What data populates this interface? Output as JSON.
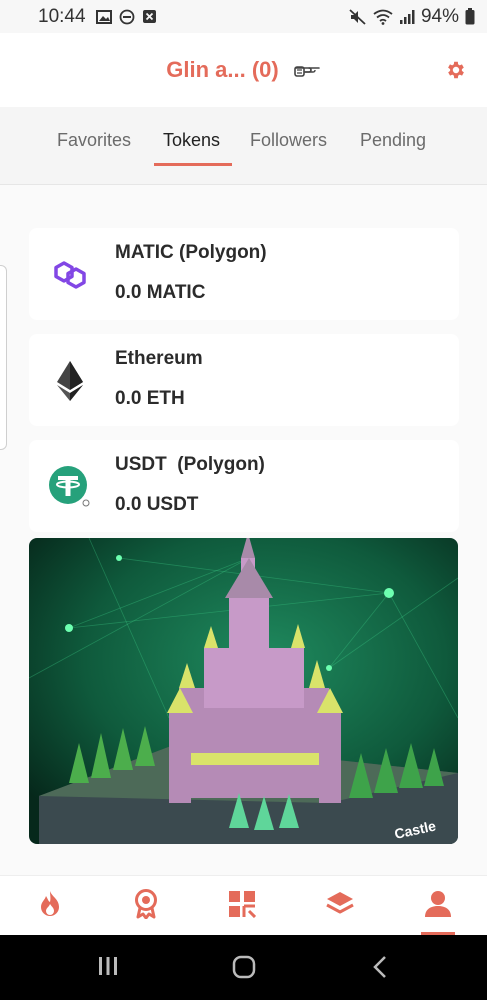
{
  "status_bar": {
    "time": "10:44",
    "battery": "94%",
    "icons_left": [
      "image-icon",
      "dnd-icon",
      "close-box-icon"
    ],
    "icons_right": [
      "mute-icon",
      "wifi-icon",
      "signal-icon",
      "battery-icon"
    ]
  },
  "header": {
    "title": "Glin a... (0)",
    "pointer_icon": "pointing-hand-icon",
    "settings_icon": "gear-icon",
    "accent_color": "#e46b5a"
  },
  "tabs": [
    {
      "label": "Favorites",
      "active": false
    },
    {
      "label": "Tokens",
      "active": true
    },
    {
      "label": "Followers",
      "active": false
    },
    {
      "label": "Pending",
      "active": false
    }
  ],
  "tokens": [
    {
      "name": "MATIC (Polygon)",
      "balance": "0.0 MATIC",
      "icon": "polygon-icon"
    },
    {
      "name": "Ethereum",
      "balance": "0.0 ETH",
      "icon": "ethereum-icon"
    },
    {
      "name": "USDT  (Polygon)",
      "balance": "0.0 USDT",
      "icon": "tether-icon"
    }
  ],
  "banner": {
    "caption": "Castle"
  },
  "bottom_nav": [
    {
      "icon": "flame-icon",
      "active": false
    },
    {
      "icon": "badge-icon",
      "active": false
    },
    {
      "icon": "grid-icon",
      "active": false
    },
    {
      "icon": "layers-icon",
      "active": false
    },
    {
      "icon": "profile-icon",
      "active": true
    }
  ],
  "system_nav": [
    "recents-button",
    "home-button",
    "back-button"
  ]
}
